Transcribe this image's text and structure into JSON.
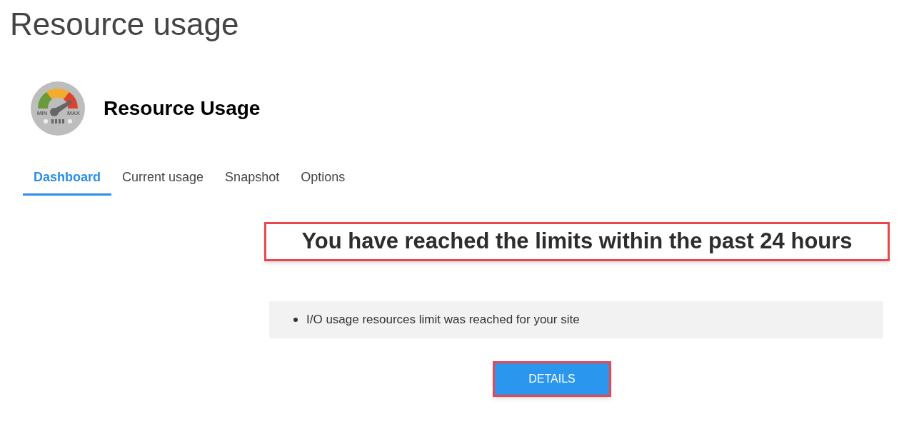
{
  "page_title": "Resource usage",
  "app": {
    "title": "Resource Usage",
    "icon_labels": [
      "MIN",
      "MAX"
    ]
  },
  "tabs": [
    {
      "label": "Dashboard",
      "selected": true
    },
    {
      "label": "Current usage",
      "selected": false
    },
    {
      "label": "Snapshot",
      "selected": false
    },
    {
      "label": "Options",
      "selected": false
    }
  ],
  "alert_heading": {
    "text": "You have reached the limits within the past 24 hours",
    "highlighted": true
  },
  "messages": [
    "I/O usage resources limit was reached for your site"
  ],
  "details_button": {
    "label": "DETAILS",
    "highlighted": true
  }
}
